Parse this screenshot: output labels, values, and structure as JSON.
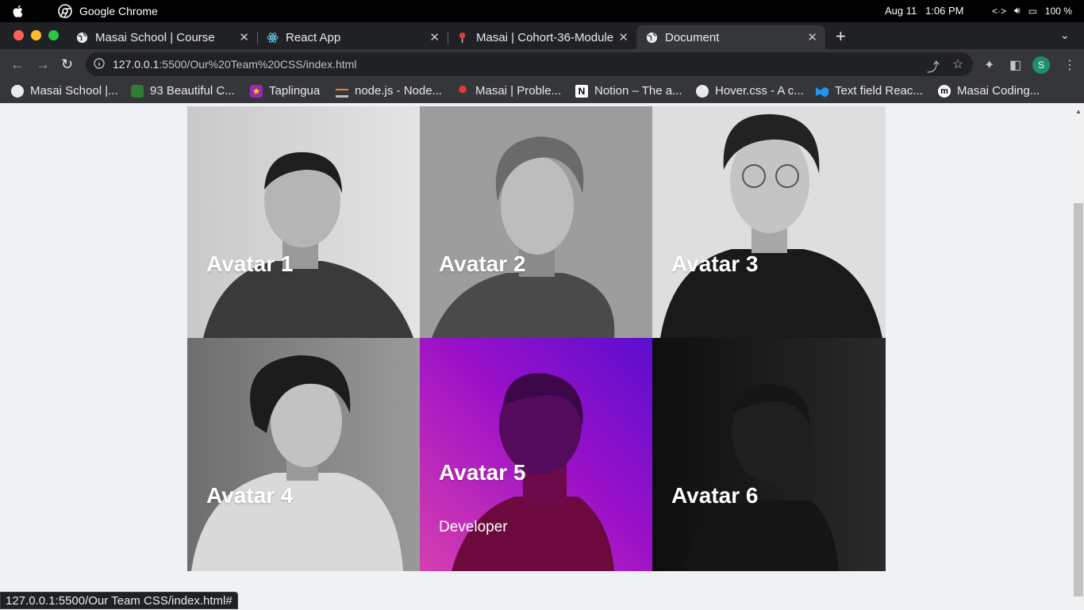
{
  "menubar": {
    "app_name": "Google Chrome",
    "date": "Aug 11",
    "time": "1:06 PM",
    "battery": "100 %"
  },
  "tabs": [
    {
      "title": "Masai School | Course",
      "icon": "globe-icon"
    },
    {
      "title": "React App",
      "icon": "react-icon"
    },
    {
      "title": "Masai | Cohort-36-Module",
      "icon": "masai-icon"
    },
    {
      "title": "Document",
      "icon": "globe-icon",
      "active": true
    }
  ],
  "omnibox": {
    "url_host": "127.0.0.1",
    "url_rest": ":5500/Our%20Team%20CSS/index.html"
  },
  "profile_initial": "S",
  "bookmarks": [
    {
      "label": "Masai School |...",
      "icon": "globe-icon"
    },
    {
      "label": "93 Beautiful C...",
      "icon": "leaf-icon"
    },
    {
      "label": "Taplingua",
      "icon": "star-icon"
    },
    {
      "label": "node.js - Node...",
      "icon": "stackoverflow-icon"
    },
    {
      "label": "Masai | Proble...",
      "icon": "masai-icon"
    },
    {
      "label": "Notion – The a...",
      "icon": "notion-icon"
    },
    {
      "label": "Hover.css - A c...",
      "icon": "globe-icon"
    },
    {
      "label": "Text field Reac...",
      "icon": "mui-icon"
    },
    {
      "label": "Masai Coding...",
      "icon": "masai-m-icon"
    }
  ],
  "team": [
    {
      "name": "Avatar 1"
    },
    {
      "name": "Avatar 2"
    },
    {
      "name": "Avatar 3"
    },
    {
      "name": "Avatar 4"
    },
    {
      "name": "Avatar 5",
      "role": "Developer",
      "hovered": true
    },
    {
      "name": "Avatar 6"
    }
  ],
  "status_bar": "127.0.0.1:5500/Our Team CSS/index.html#",
  "colors": {
    "page_bg": "#eef2f4",
    "hover_gradient_start": "#d63fae",
    "hover_gradient_end": "#5b0fd0"
  }
}
